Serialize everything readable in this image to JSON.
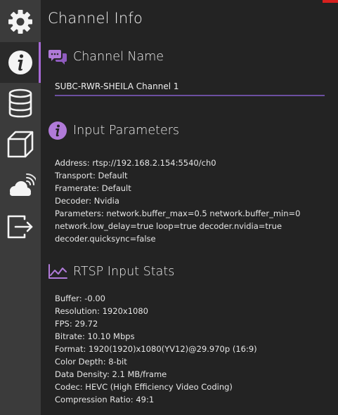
{
  "sidebar": {
    "items": [
      {
        "icon": "gear-icon"
      },
      {
        "icon": "info-icon"
      },
      {
        "icon": "database-icon"
      },
      {
        "icon": "cube-icon"
      },
      {
        "icon": "cloud-stream-icon"
      },
      {
        "icon": "export-icon"
      }
    ],
    "active_index": 1
  },
  "page": {
    "title": "Channel Info"
  },
  "channel_name": {
    "heading": "Channel Name",
    "value": "SUBC-RWR-SHEILA Channel 1"
  },
  "input_parameters": {
    "heading": "Input Parameters",
    "lines": [
      "Address: rtsp://192.168.2.154:5540/ch0",
      "Transport: Default",
      "Framerate: Default",
      "Decoder: Nvidia",
      "Parameters: network.buffer_max=0.5 network.buffer_min=0 network.low_delay=true loop=true decoder.nvidia=true decoder.quicksync=false"
    ]
  },
  "rtsp_stats": {
    "heading": "RTSP Input Stats",
    "lines": [
      "Buffer: -0.00",
      "Resolution: 1920x1080",
      "FPS: 29.72",
      "Bitrate: 10.10 Mbps",
      "Format: 1920(1920)x1080(YV12)@29.970p (16:9)",
      "Color Depth: 8-bit",
      "Data Density: 2.1 MB/frame",
      "Codec: HEVC (High Efficiency Video Coding)",
      "Compression Ratio: 49:1"
    ]
  },
  "colors": {
    "accent": "#a86ad6",
    "sidebar_bg": "#3b3b3b",
    "content_bg": "#232323"
  }
}
